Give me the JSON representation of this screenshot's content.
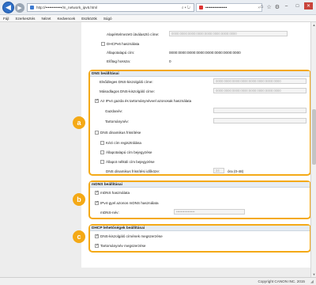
{
  "browser": {
    "url": "http://•••••••••••••/m_network_ipv6.html",
    "tab_title": "•••••••••••••••••",
    "menu": [
      "Fájl",
      "Szerkesztés",
      "Nézet",
      "Kedvencek",
      "Eszközök",
      "Súgó"
    ]
  },
  "top": {
    "default_router_label": "Alapértelmezett útválasztó címe:",
    "default_router_value": "0000:0000:0000:0000:0000:0000:0000:0000",
    "dhcpv6_label": "DHCPv6 használata",
    "stateful_label": "Állapotalapú cím:",
    "stateful_value": "0000:0000:0000:0000:0000:0000:0000:0000",
    "prefix_label": "Előtag hossza:",
    "prefix_value": "0"
  },
  "dns": {
    "title": "DNS beállításai",
    "primary_label": "Elsődleges DNS-kiszolgáló címe:",
    "primary_value": "0000:0000:0000:0000:0000:0000:0000:0000",
    "secondary_label": "Másodlagos DNS-kiszolgáló címe:",
    "secondary_value": "0000:0000:0000:0000:0000:0000:0000:0000",
    "same_host_label": "Az IPv4 gazda és tartománynévvel azonosak használata",
    "host_label": "Gazdanév:",
    "domain_label": "Tartománynév:",
    "dynamic_label": "DNS dinamikus frissítése",
    "manual_label": "Kézi cím regisztrálása",
    "stateful_reg_label": "Állapotalapú cím bejegyzése",
    "stateless_reg_label": "Állapot nélküli cím bejegyzése",
    "interval_label": "DNS dinamikus frissítési időköze:",
    "interval_value": "24",
    "interval_unit": "óra (0-48)"
  },
  "mdns": {
    "title": "mDNS beállításai",
    "use_label": "mDNS használata",
    "same_ipv4_label": "IPv4-gyel azonos mDNS használata",
    "name_label": "mDNS-név:",
    "name_value": "••••••••••••••••"
  },
  "dhcp": {
    "title": "DHCP lehetőségek beállításai",
    "dns_server_label": "DNS-kiszolgáló címének megszerzése",
    "domain_name_label": "Tartománynév megszerzése"
  },
  "markers": {
    "a": "a",
    "b": "b",
    "c": "c"
  },
  "footer": {
    "copyright": "Copyright CANON INC. 2015"
  },
  "colors": {
    "accent": "#f4a916",
    "section_header": "#e6ecf3"
  }
}
